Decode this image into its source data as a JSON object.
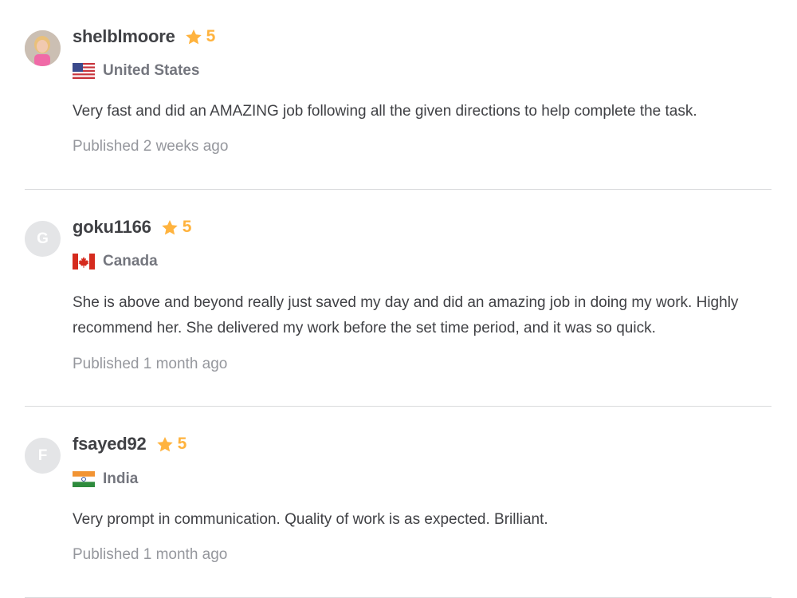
{
  "reviews": [
    {
      "username": "shelblmoore",
      "rating": "5",
      "country": "United States",
      "flag": "us-flag-icon",
      "avatar": {
        "type": "photo",
        "letter": ""
      },
      "text": "Very fast and did an AMAZING job following all the given directions to help complete the task.",
      "published": "Published 2 weeks ago"
    },
    {
      "username": "goku1166",
      "rating": "5",
      "country": "Canada",
      "flag": "canada-flag-icon",
      "avatar": {
        "type": "letter",
        "letter": "G"
      },
      "text": "She is above and beyond really just saved my day and did an amazing job in doing my work. Highly recommend her. She delivered my work before the set time period, and it was so quick.",
      "published": "Published 1 month ago"
    },
    {
      "username": "fsayed92",
      "rating": "5",
      "country": "India",
      "flag": "india-flag-icon",
      "avatar": {
        "type": "letter",
        "letter": "F"
      },
      "text": "Very prompt in communication. Quality of work is as expected. Brilliant.",
      "published": "Published 1 month ago"
    }
  ],
  "colors": {
    "star": "#ffb33e",
    "username": "#404145",
    "country": "#74767e",
    "published": "#95979d",
    "divider": "#dadbdd"
  }
}
